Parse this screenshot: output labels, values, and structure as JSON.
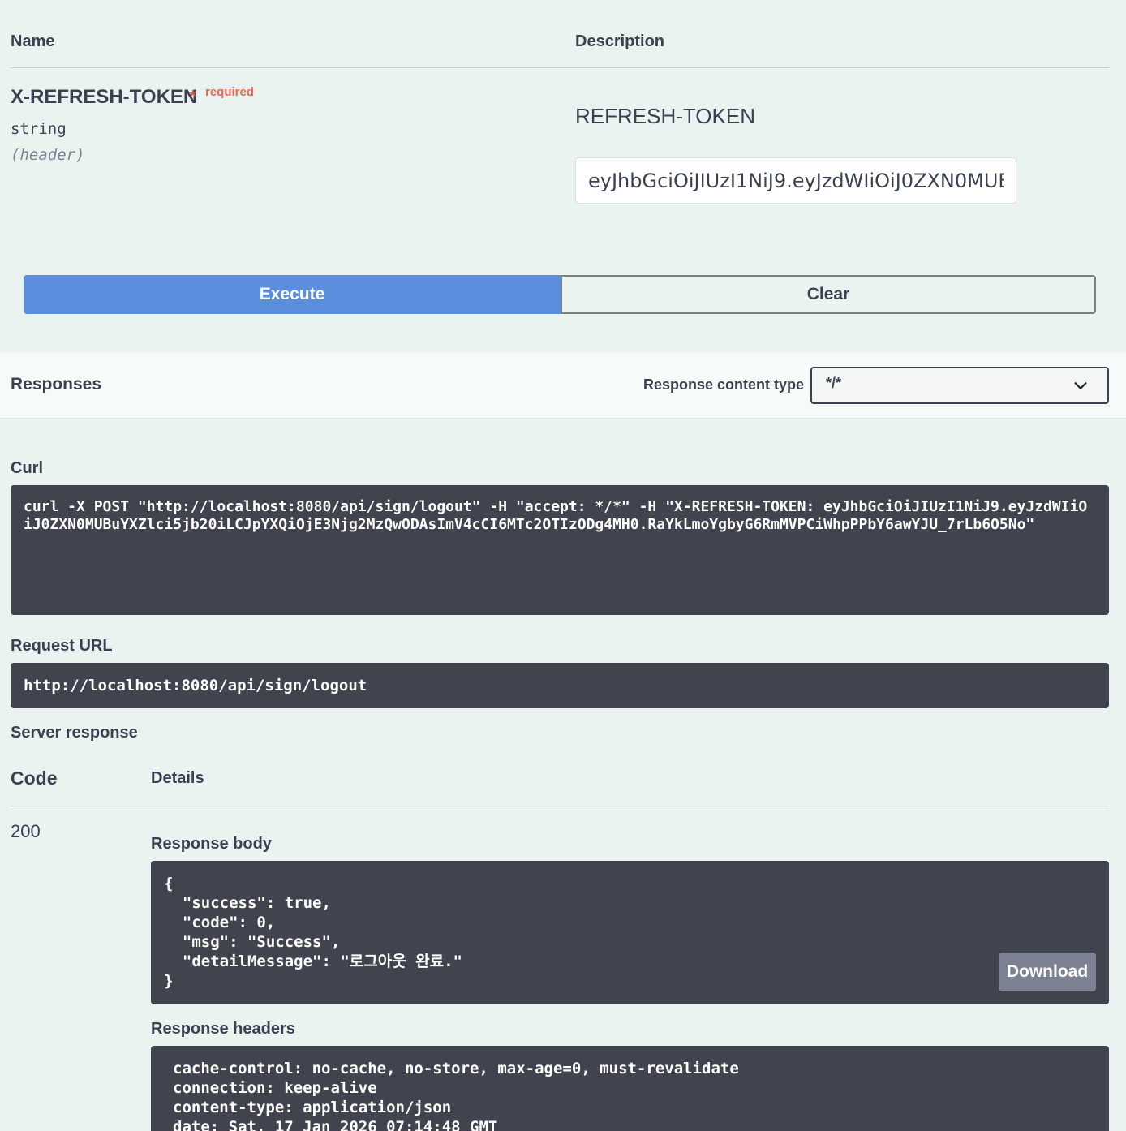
{
  "parameters": {
    "col_name": "Name",
    "col_description": "Description",
    "param_name": "X-REFRESH-TOKEN",
    "required_star": "*",
    "required_label": "required",
    "param_type": "string",
    "param_in": "(header)",
    "param_description": "REFRESH-TOKEN",
    "param_value": "eyJhbGciOiJIUzI1NiJ9.eyJzdWIiOiJ0ZXN0MUBuYXZlci5jb20iLCJpYXQiOjE3Njg2MzQwODAsImV4cCI6MTc2OTIzODg4MH0.RaYkLmoYgbyG6RmMVPCiWhpPPbY6awYJU_7rLb6O5No"
  },
  "actions": {
    "execute_label": "Execute",
    "clear_label": "Clear"
  },
  "responses": {
    "title": "Responses",
    "content_type_label": "Response content type",
    "content_type_value": "*/*"
  },
  "curl": {
    "label": "Curl",
    "command": "curl -X POST \"http://localhost:8080/api/sign/logout\" -H \"accept: */*\" -H \"X-REFRESH-TOKEN: eyJhbGciOiJIUzI1NiJ9.eyJzdWIiOiJ0ZXN0MUBuYXZlci5jb20iLCJpYXQiOjE3Njg2MzQwODAsImV4cCI6MTc2OTIzODg4MH0.RaYkLmoYgbyG6RmMVPCiWhpPPbY6awYJU_7rLb6O5No\""
  },
  "request_url": {
    "label": "Request URL",
    "value": "http://localhost:8080/api/sign/logout"
  },
  "server_response": {
    "label": "Server response",
    "col_code": "Code",
    "col_details": "Details",
    "code": "200",
    "body_label": "Response body",
    "body": "{\n  \"success\": true,\n  \"code\": 0,\n  \"msg\": \"Success\",\n  \"detailMessage\": \"로그아웃 완료.\"\n}",
    "download_label": "Download",
    "headers_label": "Response headers",
    "headers": "cache-control: no-cache, no-store, max-age=0, must-revalidate\nconnection: keep-alive\ncontent-type: application/json\ndate: Sat, 17 Jan 2026 07:14:48 GMT"
  }
}
